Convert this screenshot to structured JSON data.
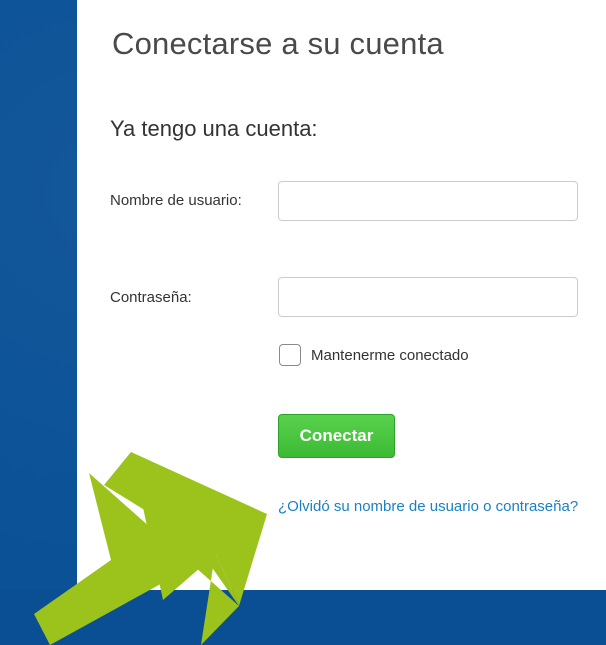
{
  "login": {
    "title": "Conectarse a su cuenta",
    "section_title": "Ya tengo una cuenta:",
    "username_label": "Nombre de usuario:",
    "username_value": "",
    "password_label": "Contraseña:",
    "password_value": "",
    "remember_label": "Mantenerme conectado",
    "remember_checked": false,
    "submit_label": "Conectar",
    "forgot_link": "¿Olvidó su nombre de usuario o contraseña?"
  },
  "colors": {
    "background": "#0a5196",
    "panel": "#ffffff",
    "button": "#45c23c",
    "link": "#1a82c4",
    "arrow": "#9bc31c"
  },
  "icons": {
    "annotation_arrow": "arrow-icon"
  }
}
